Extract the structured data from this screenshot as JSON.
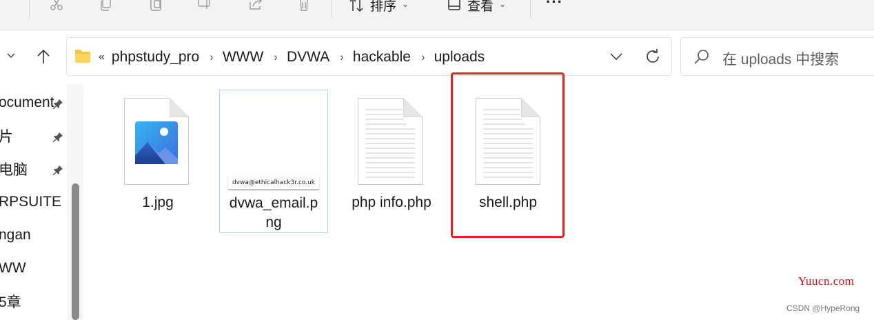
{
  "toolbar": {
    "sort_label": "排序",
    "view_label": "查看",
    "more_label": "···",
    "icons": [
      "cut-icon",
      "copy-icon",
      "paste-icon",
      "rename-icon",
      "share-icon",
      "delete-icon",
      "sort-icon",
      "view-icon"
    ]
  },
  "address": {
    "overflow": "«",
    "separator": "›",
    "crumbs": [
      "phpstudy_pro",
      "WWW",
      "DVWA",
      "hackable",
      "uploads"
    ]
  },
  "search": {
    "placeholder": "在 uploads 中搜索"
  },
  "sidebar": {
    "items": [
      {
        "label": "ocument",
        "pinned": true
      },
      {
        "label": "片",
        "pinned": true
      },
      {
        "label": "电脑",
        "pinned": true
      },
      {
        "label": "RPSUITE",
        "pinned": false
      },
      {
        "label": "ngan",
        "pinned": false
      },
      {
        "label": "WW",
        "pinned": false
      },
      {
        "label": "5章",
        "pinned": false
      }
    ]
  },
  "files": [
    {
      "name": "1.jpg",
      "type": "image"
    },
    {
      "name_line1": "dvwa_email.p",
      "name_line2": "ng",
      "type": "png-thumbnail",
      "thumb_text": "dvwa@ethicalhack3r.co.uk"
    },
    {
      "name": "php info.php",
      "type": "document"
    },
    {
      "name": "shell.php",
      "type": "document",
      "highlighted": true
    }
  ],
  "colors": {
    "highlight": "#e8211a",
    "selection_border": "#a8d4f0",
    "folder": "#f4c542",
    "watermark": "#d40f0f"
  },
  "watermarks": {
    "site": "Yuucn.com",
    "author": "CSDN @HypeRong"
  }
}
